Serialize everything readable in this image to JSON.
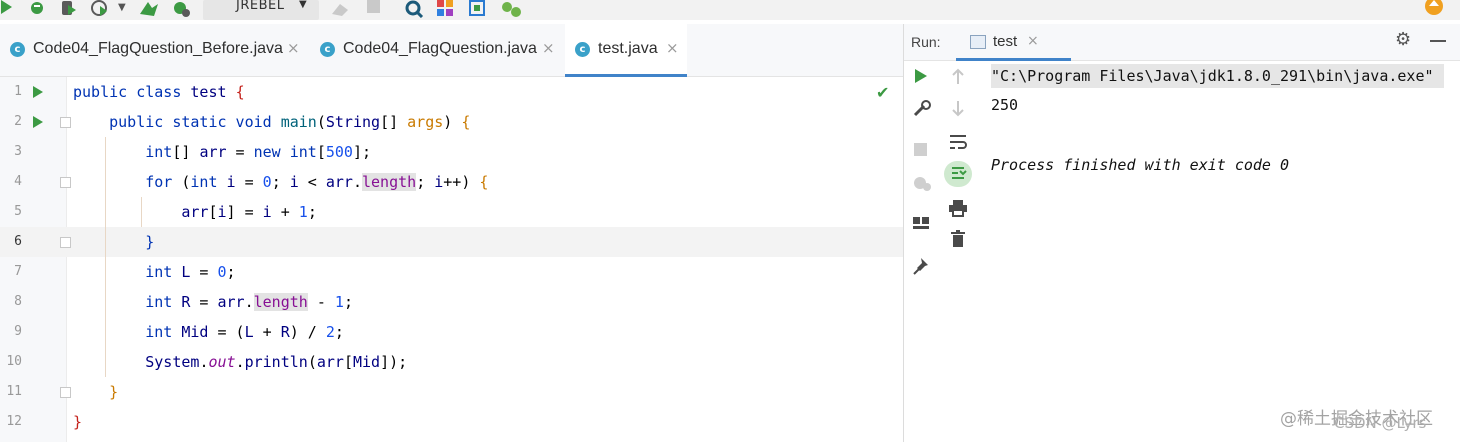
{
  "toolbar": {
    "jrebel_label": "JREBEL",
    "jrebel_caret": "▼",
    "icons": [
      "run-icon",
      "debug-icon",
      "coverage-icon",
      "profile-icon",
      "dropdown-icon",
      "build-icon",
      "build-module-icon",
      "hammer-icon",
      "stop-icon",
      "search-icon",
      "plugin-icon",
      "settings-icon",
      "git-icon",
      "update-icon"
    ]
  },
  "tabs": [
    {
      "icon": "c",
      "label": "Code04_FlagQuestion_Before.java",
      "close": "×"
    },
    {
      "icon": "c",
      "label": "Code04_FlagQuestion.java",
      "close": "×"
    },
    {
      "icon": "c",
      "label": "test.java",
      "close": "×"
    }
  ],
  "editor": {
    "line_numbers": [
      "1",
      "2",
      "3",
      "4",
      "5",
      "6",
      "7",
      "8",
      "9",
      "10",
      "11",
      "12"
    ],
    "current_line": "6",
    "check_mark": "✔"
  },
  "run_panel": {
    "label": "Run:",
    "tab_name": "test",
    "tab_close": "×",
    "settings_glyph": "⚙",
    "console": {
      "command": "\"C:\\Program Files\\Java\\jdk1.8.0_291\\bin\\java.exe\"",
      "output": "250",
      "status": "Process finished with exit code 0"
    }
  },
  "watermark": {
    "line1": "@稀土掘金技术社区",
    "line2": "CSDN @Lyrs"
  },
  "colors": {
    "keyword": "#0033b3",
    "string_brown": "#c97a00",
    "run_green": "#3c9a43",
    "tab_underline": "#4083c9"
  }
}
